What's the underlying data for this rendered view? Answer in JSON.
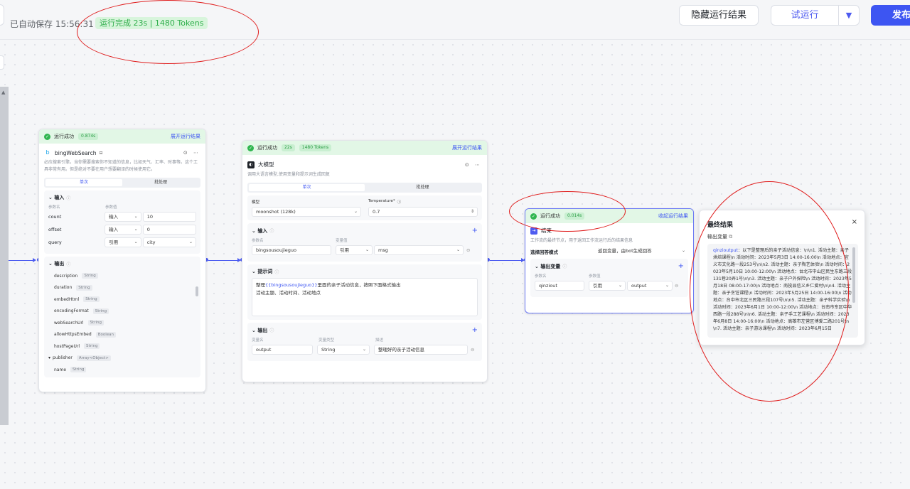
{
  "topbar": {
    "autosave": "已自动保存 15:56:31",
    "run_status": "运行完成 23s | 1480 Tokens",
    "hide_results": "隐藏运行结果",
    "try_run": "试运行",
    "try_run_dropdown": "▼",
    "publish": "发布"
  },
  "colors": {
    "accent": "#3d55f2",
    "success": "#30b64f",
    "annotation": "#e01e1e"
  },
  "search_node": {
    "status": "运行成功",
    "time": "0.874s",
    "expand": "展开运行结果",
    "title": "bingWebSearch",
    "desc": "必应搜索引擎。当你需要搜索你不知道的信息，比如天气、汇率、时事等。这个工具非常有用。但是绝对不要在用户想要翻译的时候使用它。",
    "tab_single": "单次",
    "tab_batch": "批处理",
    "input_label": "输入",
    "col_param": "参数名",
    "col_value": "参数值",
    "inputs": [
      {
        "name": "count",
        "mode": "输入",
        "value": "10"
      },
      {
        "name": "offset",
        "mode": "输入",
        "value": "0"
      },
      {
        "name": "query",
        "mode": "引用",
        "value": "city"
      }
    ],
    "output_label": "输出",
    "outputs": [
      {
        "name": "description",
        "type": "String"
      },
      {
        "name": "duration",
        "type": "String"
      },
      {
        "name": "embedHtml",
        "type": "String"
      },
      {
        "name": "encodingFormat",
        "type": "String"
      },
      {
        "name": "webSearchUrl",
        "type": "String"
      },
      {
        "name": "allowHttpsEmbed",
        "type": "Boolean"
      },
      {
        "name": "hostPageUrl",
        "type": "String"
      },
      {
        "name": "publisher",
        "type": "Array<Object>"
      },
      {
        "name": "name",
        "type": "String"
      }
    ]
  },
  "llm_node": {
    "status": "运行成功",
    "time": "22s",
    "tokens": "1480 Tokens",
    "expand": "展开运行结果",
    "title": "大模型",
    "desc": "调用大语言模型,使用变量和提示词生成回复",
    "tab_single": "单次",
    "tab_batch": "批处理",
    "model_label": "模型",
    "model_value": "moonshot (128k)",
    "temp_label": "Temperature*",
    "temp_value": "0.7",
    "input_label": "输入",
    "col_param": "参数名",
    "col_value": "变量值",
    "input_name": "bingsousoujieguo",
    "input_mode": "引用",
    "input_ref": "msg",
    "prompt_label": "提示词",
    "prompt_line1_pre": "整理",
    "prompt_var": "{{bingsousoujieguo}}",
    "prompt_line1_post": "里面的亲子活动信息，按照下面格式输出",
    "prompt_line2": "活动主题、活动时间、活动地点",
    "output_label": "输出",
    "out_col_name": "变量名",
    "out_col_type": "变量类型",
    "out_col_desc": "描述",
    "out_name": "output",
    "out_type": "String",
    "out_desc": "整理好的亲子活动信息"
  },
  "end_node": {
    "status": "运行成功",
    "time": "0.014s",
    "collapse": "收起运行结果",
    "title": "结束",
    "desc": "工作流的最终节点，用于返回工作流运行后的结果信息",
    "mode_label": "选择回答模式",
    "mode_value": "返回变量，由bot生成回答",
    "output_label": "输出变量",
    "col_param": "参数名",
    "col_value": "参数值",
    "var_name": "qinziout",
    "var_mode": "引用",
    "var_ref": "output"
  },
  "final_result": {
    "title": "最终结果",
    "close": "×",
    "sub": "输出变量",
    "var": "qinzioutput",
    "content": "：以下是整理后的亲子活动信息：\\n\\n1. 活动主题：亲子烘焙课程\\n 活动时间：2023年5月3日 14:00-16:00\\n 活动地点：宜义市文化路一段253号\\n\\n2. 活动主题：亲子陶艺体验\\n 活动时间：2023年5月10日 10:00-12:00\\n 活动地点：台北市中山区民生东路三段131巷20弄1号\\n\\n3. 活动主题：亲子户外探险\\n 活动时间：2023年5月18日 08:00-17:00\\n 活动地点：南投县信义乡仁爱村\\n\\n4. 活动主题：亲子烹饪课程\\n 活动时间：2023年5月25日 14:00-16:00\\n 活动地点：台中市北区三民路三段107号\\n\\n5. 活动主题：亲子科学实验\\n 活动时间：2023年6月1日 10:00-12:00\\n 活动地点：台南市东区中华西路一段288号\\n\\n6. 活动主题：亲子手工艺课程\\n 活动时间：2023年6月8日 14:00-16:00\\n 活动地点：高雄市左营区博爱二路201号\\n\\n7. 活动主题：亲子游泳课程\\n 活动时间：2023年6月15日"
  }
}
